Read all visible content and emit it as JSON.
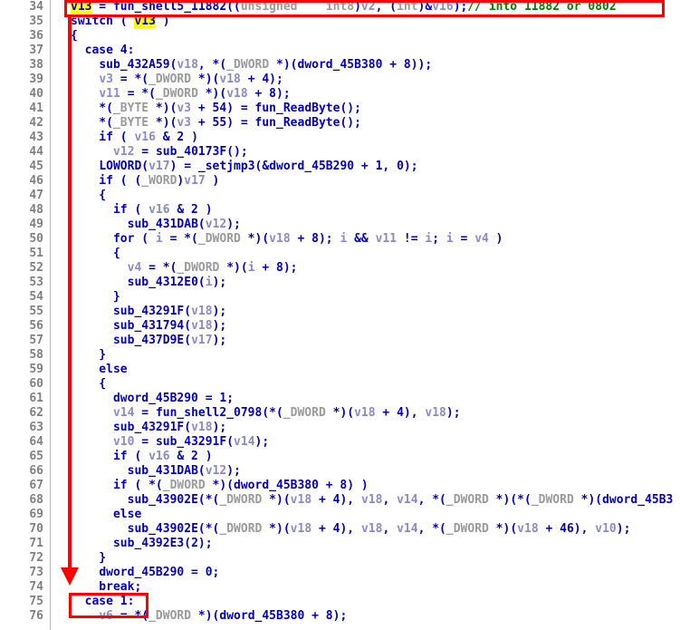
{
  "view": {
    "kind": "decompiler-pseudocode-listing",
    "first_line": 34,
    "last_line": 76
  },
  "annotations": {
    "highlight_token": "v13",
    "top_box_label": "call-to-fun_shell5_11882",
    "bottom_box_label": "case 1:",
    "arrow_label": "flow-arrow-down"
  },
  "colors": {
    "annotation": "#ff0000",
    "highlight": "#ffff00",
    "keyword": "#0000c0",
    "comment": "#008000",
    "variable": "#8a8ac8",
    "type": "#9a9a9a",
    "lineno": "#808080",
    "background": "#ffffff"
  },
  "lines": [
    {
      "n": "34",
      "tokens": [
        {
          "t": "v13",
          "c": "hl"
        },
        {
          "t": " = ",
          "c": "punc"
        },
        {
          "t": "fun_shell5_11882",
          "c": "fn"
        },
        {
          "t": "((",
          "c": "punc"
        },
        {
          "t": "unsigned    int8",
          "c": "typ"
        },
        {
          "t": ")",
          "c": "punc"
        },
        {
          "t": "v2",
          "c": "var"
        },
        {
          "t": ", (",
          "c": "punc"
        },
        {
          "t": "int",
          "c": "typ"
        },
        {
          "t": ")&",
          "c": "punc"
        },
        {
          "t": "v16",
          "c": "var"
        },
        {
          "t": ");",
          "c": "punc"
        },
        {
          "t": "// into 11882 or 0802",
          "c": "cmt"
        }
      ]
    },
    {
      "n": "35",
      "tokens": [
        {
          "t": "switch ( ",
          "c": "kw"
        },
        {
          "t": "v13",
          "c": "hl"
        },
        {
          "t": " )",
          "c": "kw"
        }
      ]
    },
    {
      "n": "36",
      "tokens": [
        {
          "t": "{",
          "c": "punc"
        }
      ]
    },
    {
      "n": "37",
      "tokens": [
        {
          "t": "  case 4:",
          "c": "kw"
        }
      ]
    },
    {
      "n": "38",
      "tokens": [
        {
          "t": "    ",
          "c": "punc"
        },
        {
          "t": "sub_432A59",
          "c": "fn"
        },
        {
          "t": "(",
          "c": "punc"
        },
        {
          "t": "v18",
          "c": "var"
        },
        {
          "t": ", *(",
          "c": "punc"
        },
        {
          "t": "_DWORD",
          "c": "typ"
        },
        {
          "t": " *)(",
          "c": "punc"
        },
        {
          "t": "dword_45B380",
          "c": "fn"
        },
        {
          "t": " + 8));",
          "c": "punc"
        }
      ]
    },
    {
      "n": "39",
      "tokens": [
        {
          "t": "    ",
          "c": "punc"
        },
        {
          "t": "v3",
          "c": "var"
        },
        {
          "t": " = *(",
          "c": "punc"
        },
        {
          "t": "_DWORD",
          "c": "typ"
        },
        {
          "t": " *)(",
          "c": "punc"
        },
        {
          "t": "v18",
          "c": "var"
        },
        {
          "t": " + 4);",
          "c": "punc"
        }
      ]
    },
    {
      "n": "40",
      "tokens": [
        {
          "t": "    ",
          "c": "punc"
        },
        {
          "t": "v11",
          "c": "var"
        },
        {
          "t": " = *(",
          "c": "punc"
        },
        {
          "t": "_DWORD",
          "c": "typ"
        },
        {
          "t": " *)(",
          "c": "punc"
        },
        {
          "t": "v18",
          "c": "var"
        },
        {
          "t": " + 8);",
          "c": "punc"
        }
      ]
    },
    {
      "n": "41",
      "tokens": [
        {
          "t": "    *(",
          "c": "punc"
        },
        {
          "t": "_BYTE",
          "c": "typ"
        },
        {
          "t": " *)(",
          "c": "punc"
        },
        {
          "t": "v3",
          "c": "var"
        },
        {
          "t": " + 54) = ",
          "c": "punc"
        },
        {
          "t": "fun_ReadByte",
          "c": "fn"
        },
        {
          "t": "();",
          "c": "punc"
        }
      ]
    },
    {
      "n": "42",
      "tokens": [
        {
          "t": "    *(",
          "c": "punc"
        },
        {
          "t": "_BYTE",
          "c": "typ"
        },
        {
          "t": " *)(",
          "c": "punc"
        },
        {
          "t": "v3",
          "c": "var"
        },
        {
          "t": " + 55) = ",
          "c": "punc"
        },
        {
          "t": "fun_ReadByte",
          "c": "fn"
        },
        {
          "t": "();",
          "c": "punc"
        }
      ]
    },
    {
      "n": "43",
      "tokens": [
        {
          "t": "    if ( ",
          "c": "kw"
        },
        {
          "t": "v16",
          "c": "var"
        },
        {
          "t": " & 2 )",
          "c": "punc"
        }
      ]
    },
    {
      "n": "44",
      "tokens": [
        {
          "t": "      ",
          "c": "punc"
        },
        {
          "t": "v12",
          "c": "var"
        },
        {
          "t": " = ",
          "c": "punc"
        },
        {
          "t": "sub_40173F",
          "c": "fn"
        },
        {
          "t": "();",
          "c": "punc"
        }
      ]
    },
    {
      "n": "45",
      "tokens": [
        {
          "t": "    ",
          "c": "punc"
        },
        {
          "t": "LOWORD",
          "c": "fn"
        },
        {
          "t": "(",
          "c": "punc"
        },
        {
          "t": "v17",
          "c": "var"
        },
        {
          "t": ") = ",
          "c": "punc"
        },
        {
          "t": "_setjmp3",
          "c": "fn"
        },
        {
          "t": "(&",
          "c": "punc"
        },
        {
          "t": "dword_45B290",
          "c": "fn"
        },
        {
          "t": " + 1, 0);",
          "c": "punc"
        }
      ]
    },
    {
      "n": "46",
      "tokens": [
        {
          "t": "    if ( (",
          "c": "kw"
        },
        {
          "t": "_WORD",
          "c": "typ"
        },
        {
          "t": ")",
          "c": "punc"
        },
        {
          "t": "v17",
          "c": "var"
        },
        {
          "t": " )",
          "c": "punc"
        }
      ]
    },
    {
      "n": "47",
      "tokens": [
        {
          "t": "    {",
          "c": "punc"
        }
      ]
    },
    {
      "n": "48",
      "tokens": [
        {
          "t": "      if ( ",
          "c": "kw"
        },
        {
          "t": "v16",
          "c": "var"
        },
        {
          "t": " & 2 )",
          "c": "punc"
        }
      ]
    },
    {
      "n": "49",
      "tokens": [
        {
          "t": "        ",
          "c": "punc"
        },
        {
          "t": "sub_431DAB",
          "c": "fn"
        },
        {
          "t": "(",
          "c": "punc"
        },
        {
          "t": "v12",
          "c": "var"
        },
        {
          "t": ");",
          "c": "punc"
        }
      ]
    },
    {
      "n": "50",
      "tokens": [
        {
          "t": "      for ( ",
          "c": "kw"
        },
        {
          "t": "i",
          "c": "var"
        },
        {
          "t": " = *(",
          "c": "punc"
        },
        {
          "t": "_DWORD",
          "c": "typ"
        },
        {
          "t": " *)(",
          "c": "punc"
        },
        {
          "t": "v18",
          "c": "var"
        },
        {
          "t": " + 8); ",
          "c": "punc"
        },
        {
          "t": "i",
          "c": "var"
        },
        {
          "t": " && ",
          "c": "punc"
        },
        {
          "t": "v11",
          "c": "var"
        },
        {
          "t": " != ",
          "c": "punc"
        },
        {
          "t": "i",
          "c": "var"
        },
        {
          "t": "; ",
          "c": "punc"
        },
        {
          "t": "i",
          "c": "var"
        },
        {
          "t": " = ",
          "c": "punc"
        },
        {
          "t": "v4",
          "c": "var"
        },
        {
          "t": " )",
          "c": "punc"
        }
      ]
    },
    {
      "n": "51",
      "tokens": [
        {
          "t": "      {",
          "c": "punc"
        }
      ]
    },
    {
      "n": "52",
      "tokens": [
        {
          "t": "        ",
          "c": "punc"
        },
        {
          "t": "v4",
          "c": "var"
        },
        {
          "t": " = *(",
          "c": "punc"
        },
        {
          "t": "_DWORD",
          "c": "typ"
        },
        {
          "t": " *)(",
          "c": "punc"
        },
        {
          "t": "i",
          "c": "var"
        },
        {
          "t": " + 8);",
          "c": "punc"
        }
      ]
    },
    {
      "n": "53",
      "tokens": [
        {
          "t": "        ",
          "c": "punc"
        },
        {
          "t": "sub_4312E0",
          "c": "fn"
        },
        {
          "t": "(",
          "c": "punc"
        },
        {
          "t": "i",
          "c": "var"
        },
        {
          "t": ");",
          "c": "punc"
        }
      ]
    },
    {
      "n": "54",
      "tokens": [
        {
          "t": "      }",
          "c": "punc"
        }
      ]
    },
    {
      "n": "55",
      "tokens": [
        {
          "t": "      ",
          "c": "punc"
        },
        {
          "t": "sub_43291F",
          "c": "fn"
        },
        {
          "t": "(",
          "c": "punc"
        },
        {
          "t": "v18",
          "c": "var"
        },
        {
          "t": ");",
          "c": "punc"
        }
      ]
    },
    {
      "n": "56",
      "tokens": [
        {
          "t": "      ",
          "c": "punc"
        },
        {
          "t": "sub_431794",
          "c": "fn"
        },
        {
          "t": "(",
          "c": "punc"
        },
        {
          "t": "v18",
          "c": "var"
        },
        {
          "t": ");",
          "c": "punc"
        }
      ]
    },
    {
      "n": "57",
      "tokens": [
        {
          "t": "      ",
          "c": "punc"
        },
        {
          "t": "sub_437D9E",
          "c": "fn"
        },
        {
          "t": "(",
          "c": "punc"
        },
        {
          "t": "v17",
          "c": "var"
        },
        {
          "t": ");",
          "c": "punc"
        }
      ]
    },
    {
      "n": "58",
      "tokens": [
        {
          "t": "    }",
          "c": "punc"
        }
      ]
    },
    {
      "n": "59",
      "tokens": [
        {
          "t": "    else",
          "c": "kw"
        }
      ]
    },
    {
      "n": "60",
      "tokens": [
        {
          "t": "    {",
          "c": "punc"
        }
      ]
    },
    {
      "n": "61",
      "tokens": [
        {
          "t": "      ",
          "c": "punc"
        },
        {
          "t": "dword_45B290",
          "c": "fn"
        },
        {
          "t": " = 1;",
          "c": "punc"
        }
      ]
    },
    {
      "n": "62",
      "tokens": [
        {
          "t": "      ",
          "c": "punc"
        },
        {
          "t": "v14",
          "c": "var"
        },
        {
          "t": " = ",
          "c": "punc"
        },
        {
          "t": "fun_shell2_0798",
          "c": "fn"
        },
        {
          "t": "(*(",
          "c": "punc"
        },
        {
          "t": "_DWORD",
          "c": "typ"
        },
        {
          "t": " *)(",
          "c": "punc"
        },
        {
          "t": "v18",
          "c": "var"
        },
        {
          "t": " + 4), ",
          "c": "punc"
        },
        {
          "t": "v18",
          "c": "var"
        },
        {
          "t": ");",
          "c": "punc"
        }
      ]
    },
    {
      "n": "63",
      "tokens": [
        {
          "t": "      ",
          "c": "punc"
        },
        {
          "t": "sub_43291F",
          "c": "fn"
        },
        {
          "t": "(",
          "c": "punc"
        },
        {
          "t": "v18",
          "c": "var"
        },
        {
          "t": ");",
          "c": "punc"
        }
      ]
    },
    {
      "n": "64",
      "tokens": [
        {
          "t": "      ",
          "c": "punc"
        },
        {
          "t": "v10",
          "c": "var"
        },
        {
          "t": " = ",
          "c": "punc"
        },
        {
          "t": "sub_43291F",
          "c": "fn"
        },
        {
          "t": "(",
          "c": "punc"
        },
        {
          "t": "v14",
          "c": "var"
        },
        {
          "t": ");",
          "c": "punc"
        }
      ]
    },
    {
      "n": "65",
      "tokens": [
        {
          "t": "      if ( ",
          "c": "kw"
        },
        {
          "t": "v16",
          "c": "var"
        },
        {
          "t": " & 2 )",
          "c": "punc"
        }
      ]
    },
    {
      "n": "66",
      "tokens": [
        {
          "t": "        ",
          "c": "punc"
        },
        {
          "t": "sub_431DAB",
          "c": "fn"
        },
        {
          "t": "(",
          "c": "punc"
        },
        {
          "t": "v12",
          "c": "var"
        },
        {
          "t": ");",
          "c": "punc"
        }
      ]
    },
    {
      "n": "67",
      "tokens": [
        {
          "t": "      if ( *(",
          "c": "kw"
        },
        {
          "t": "_DWORD",
          "c": "typ"
        },
        {
          "t": " *)(",
          "c": "punc"
        },
        {
          "t": "dword_45B380",
          "c": "fn"
        },
        {
          "t": " + 8) )",
          "c": "punc"
        }
      ]
    },
    {
      "n": "68",
      "tokens": [
        {
          "t": "        ",
          "c": "punc"
        },
        {
          "t": "sub_43902E",
          "c": "fn"
        },
        {
          "t": "(*(",
          "c": "punc"
        },
        {
          "t": "_DWORD",
          "c": "typ"
        },
        {
          "t": " *)(",
          "c": "punc"
        },
        {
          "t": "v18",
          "c": "var"
        },
        {
          "t": " + 4), ",
          "c": "punc"
        },
        {
          "t": "v18",
          "c": "var"
        },
        {
          "t": ", ",
          "c": "punc"
        },
        {
          "t": "v14",
          "c": "var"
        },
        {
          "t": ", *(",
          "c": "punc"
        },
        {
          "t": "_DWORD",
          "c": "typ"
        },
        {
          "t": " *)(*(",
          "c": "punc"
        },
        {
          "t": "_DWORD",
          "c": "typ"
        },
        {
          "t": " *)(",
          "c": "punc"
        },
        {
          "t": "dword_45B3",
          "c": "fn"
        }
      ]
    },
    {
      "n": "69",
      "tokens": [
        {
          "t": "      else",
          "c": "kw"
        }
      ]
    },
    {
      "n": "70",
      "tokens": [
        {
          "t": "        ",
          "c": "punc"
        },
        {
          "t": "sub_43902E",
          "c": "fn"
        },
        {
          "t": "(*(",
          "c": "punc"
        },
        {
          "t": "_DWORD",
          "c": "typ"
        },
        {
          "t": " *)(",
          "c": "punc"
        },
        {
          "t": "v18",
          "c": "var"
        },
        {
          "t": " + 4), ",
          "c": "punc"
        },
        {
          "t": "v18",
          "c": "var"
        },
        {
          "t": ", ",
          "c": "punc"
        },
        {
          "t": "v14",
          "c": "var"
        },
        {
          "t": ", *(",
          "c": "punc"
        },
        {
          "t": "_DWORD",
          "c": "typ"
        },
        {
          "t": " *)(",
          "c": "punc"
        },
        {
          "t": "v18",
          "c": "var"
        },
        {
          "t": " + 46), ",
          "c": "punc"
        },
        {
          "t": "v10",
          "c": "var"
        },
        {
          "t": ");",
          "c": "punc"
        }
      ]
    },
    {
      "n": "71",
      "tokens": [
        {
          "t": "      ",
          "c": "punc"
        },
        {
          "t": "sub_4392E3",
          "c": "fn"
        },
        {
          "t": "(2);",
          "c": "punc"
        }
      ]
    },
    {
      "n": "72",
      "tokens": [
        {
          "t": "    }",
          "c": "punc"
        }
      ]
    },
    {
      "n": "73",
      "tokens": [
        {
          "t": "    ",
          "c": "punc"
        },
        {
          "t": "dword_45B290",
          "c": "fn"
        },
        {
          "t": " = 0;",
          "c": "punc"
        }
      ]
    },
    {
      "n": "74",
      "tokens": [
        {
          "t": "    break;",
          "c": "kw"
        }
      ]
    },
    {
      "n": "75",
      "tokens": [
        {
          "t": "  case 1:",
          "c": "kw"
        }
      ]
    },
    {
      "n": "76",
      "tokens": [
        {
          "t": "    ",
          "c": "punc"
        },
        {
          "t": "v6",
          "c": "var"
        },
        {
          "t": " = *(",
          "c": "punc"
        },
        {
          "t": "_DWORD",
          "c": "typ"
        },
        {
          "t": " *)(",
          "c": "punc"
        },
        {
          "t": "dword_45B380",
          "c": "fn"
        },
        {
          "t": " + 8);",
          "c": "punc"
        }
      ]
    }
  ]
}
